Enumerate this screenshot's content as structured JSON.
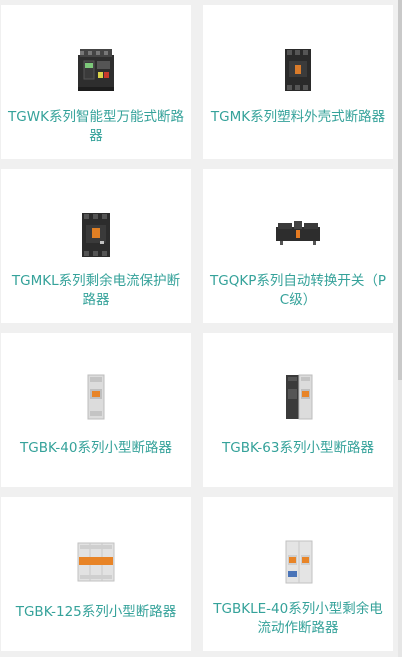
{
  "products": [
    {
      "name": "TGWK系列智能型万能式断路器",
      "icon": "air-circuit-breaker-icon"
    },
    {
      "name": "TGMK系列塑料外壳式断路器",
      "icon": "molded-case-breaker-icon"
    },
    {
      "name": "TGMKL系列剩余电流保护断路器",
      "icon": "residual-current-breaker-icon"
    },
    {
      "name": "TGQKP系列自动转换开关（PC级）",
      "icon": "transfer-switch-icon"
    },
    {
      "name": "TGBK-40系列小型断路器",
      "icon": "miniature-breaker-1p-icon"
    },
    {
      "name": "TGBK-63系列小型断路器",
      "icon": "miniature-breaker-2p-icon"
    },
    {
      "name": "TGBK-125系列小型断路器",
      "icon": "miniature-breaker-3p-icon"
    },
    {
      "name": "TGBKLE-40系列小型剩余电流动作断路器",
      "icon": "rcbo-breaker-icon"
    }
  ],
  "colors": {
    "label": "#35a29a",
    "background": "#f0f0f0",
    "card": "#ffffff"
  }
}
